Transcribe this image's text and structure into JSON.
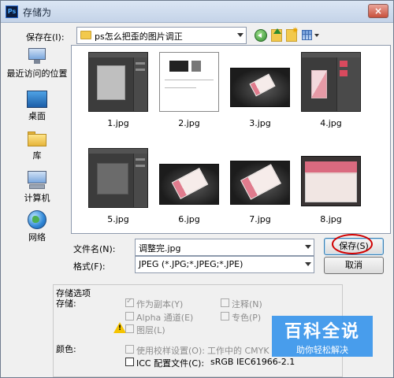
{
  "window": {
    "title": "存储为",
    "app_icon": "Ps",
    "close_icon": "×"
  },
  "save_in": {
    "label": "保存在(I):",
    "folder": "ps怎么把歪的图片调正"
  },
  "toolbar": {
    "back": "back-icon",
    "up": "up-folder-icon",
    "new_folder": "new-folder-icon",
    "view": "view-menu-icon"
  },
  "places": [
    {
      "label": "最近访问的位置",
      "icon": "recent-places-icon"
    },
    {
      "label": "桌面",
      "icon": "desktop-icon"
    },
    {
      "label": "库",
      "icon": "libraries-icon"
    },
    {
      "label": "计算机",
      "icon": "computer-icon"
    },
    {
      "label": "网络",
      "icon": "network-icon"
    }
  ],
  "files": [
    "1.jpg",
    "2.jpg",
    "3.jpg",
    "4.jpg",
    "5.jpg",
    "6.jpg",
    "7.jpg",
    "8.jpg"
  ],
  "filename": {
    "label": "文件名(N):",
    "value": "调整完.jpg"
  },
  "format": {
    "label": "格式(F):",
    "value": "JPEG (*.JPG;*.JPEG;*.JPE)"
  },
  "buttons": {
    "save": "保存(S)",
    "cancel": "取消"
  },
  "options": {
    "section_title": "存储选项",
    "store_label": "存储:",
    "as_copy": "作为副本(Y)",
    "notes": "注释(N)",
    "alpha": "Alpha 通道(E)",
    "spot": "专色(P)",
    "layers": "图层(L)",
    "color_label": "颜色:",
    "proof": "使用校样设置(O):",
    "proof_value": "工作中的 CMYK",
    "icc": "ICC 配置文件(C):",
    "icc_value": "sRGB IEC61966-2.1"
  },
  "watermark": {
    "line1": "百科全说",
    "line2": "助你轻松解决"
  },
  "colors": {
    "highlight_circle": "#d10000",
    "watermark_bg": "#3a96ec"
  }
}
